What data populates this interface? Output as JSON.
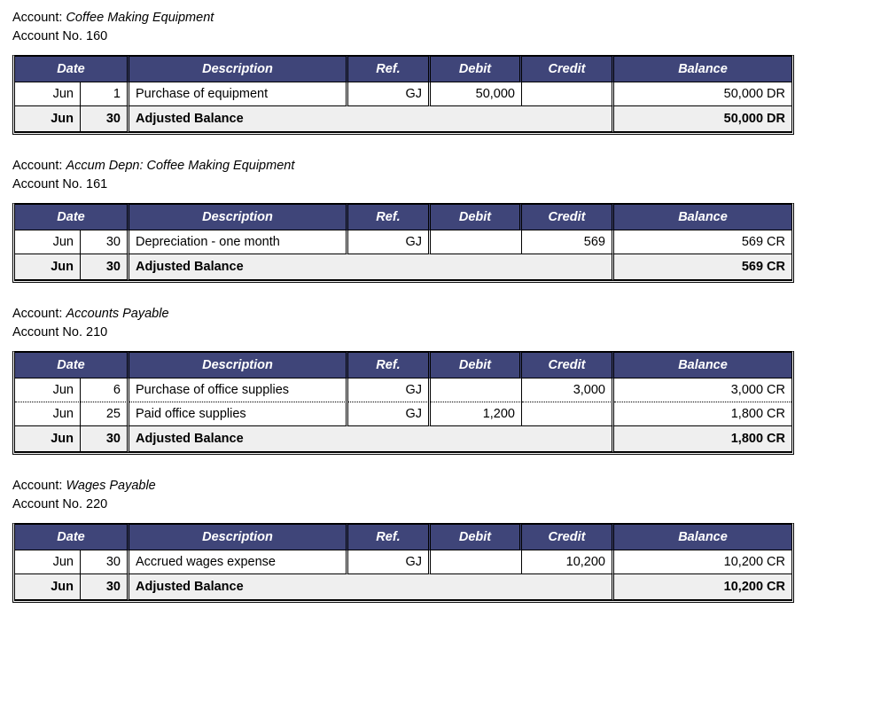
{
  "columns": {
    "date": "Date",
    "description": "Description",
    "ref": "Ref.",
    "debit": "Debit",
    "credit": "Credit",
    "balance": "Balance"
  },
  "labels": {
    "account_prefix": "Account:",
    "account_number_prefix": "Account No."
  },
  "colors": {
    "header_background": "#3f4579",
    "header_text": "#ffffff",
    "summary_row_background": "#efefef",
    "border": "#000000",
    "page_background": "#ffffff"
  },
  "ledgers": [
    {
      "account_name": "Coffee Making Equipment",
      "account_number": "160",
      "rows": [
        {
          "month": "Jun",
          "day": "1",
          "description": "Purchase of equipment",
          "ref": "GJ",
          "debit": "50,000",
          "credit": "",
          "balance": "50,000 DR"
        }
      ],
      "summary": {
        "month": "Jun",
        "day": "30",
        "description": "Adjusted Balance",
        "balance": "50,000 DR"
      }
    },
    {
      "account_name": "Accum Depn: Coffee Making Equipment",
      "account_number": "161",
      "rows": [
        {
          "month": "Jun",
          "day": "30",
          "description": "Depreciation - one month",
          "ref": "GJ",
          "debit": "",
          "credit": "569",
          "balance": "569 CR"
        }
      ],
      "summary": {
        "month": "Jun",
        "day": "30",
        "description": "Adjusted Balance",
        "balance": "569 CR"
      }
    },
    {
      "account_name": "Accounts Payable",
      "account_number": "210",
      "rows": [
        {
          "month": "Jun",
          "day": "6",
          "description": "Purchase of office supplies",
          "ref": "GJ",
          "debit": "",
          "credit": "3,000",
          "balance": "3,000 CR"
        },
        {
          "month": "Jun",
          "day": "25",
          "description": "Paid office supplies",
          "ref": "GJ",
          "debit": "1,200",
          "credit": "",
          "balance": "1,800 CR"
        }
      ],
      "summary": {
        "month": "Jun",
        "day": "30",
        "description": "Adjusted Balance",
        "balance": "1,800 CR"
      }
    },
    {
      "account_name": "Wages Payable",
      "account_number": "220",
      "rows": [
        {
          "month": "Jun",
          "day": "30",
          "description": "Accrued wages expense",
          "ref": "GJ",
          "debit": "",
          "credit": "10,200",
          "balance": "10,200 CR"
        }
      ],
      "summary": {
        "month": "Jun",
        "day": "30",
        "description": "Adjusted Balance",
        "balance": "10,200 CR"
      }
    }
  ]
}
